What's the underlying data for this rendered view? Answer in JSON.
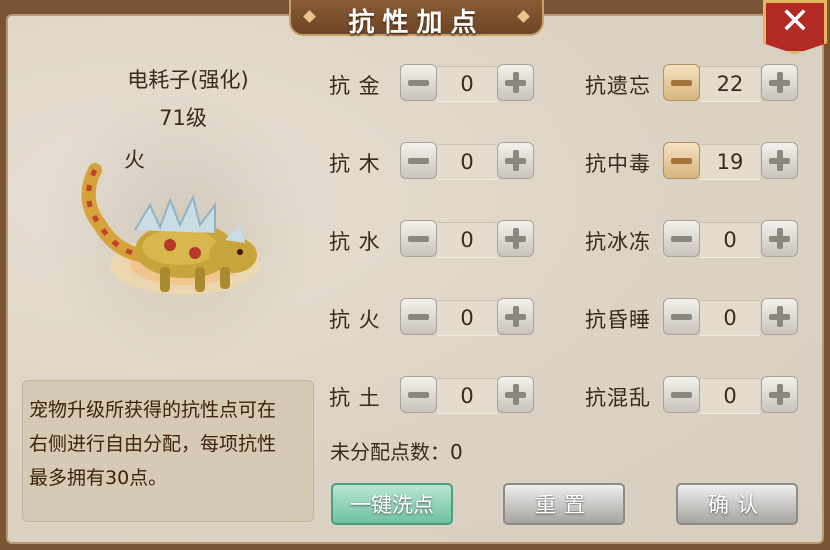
{
  "window": {
    "title": "抗性加点",
    "close_label": "✕"
  },
  "pet": {
    "name": "电耗子(强化)",
    "level": "71级",
    "element": "火"
  },
  "description": {
    "line1": "宠物升级所获得的抗性点可在",
    "line2": "右侧进行自由分配，每项抗性",
    "line3": "最多拥有30点。"
  },
  "stats_left": [
    {
      "label": "抗 金",
      "value": "0"
    },
    {
      "label": "抗 木",
      "value": "0"
    },
    {
      "label": "抗 水",
      "value": "0"
    },
    {
      "label": "抗 火",
      "value": "0"
    },
    {
      "label": "抗 土",
      "value": "0"
    }
  ],
  "stats_right": [
    {
      "label": "抗遗忘",
      "value": "22"
    },
    {
      "label": "抗中毒",
      "value": "19"
    },
    {
      "label": "抗冰冻",
      "value": "0"
    },
    {
      "label": "抗昏睡",
      "value": "0"
    },
    {
      "label": "抗混乱",
      "value": "0"
    }
  ],
  "unallocated": "未分配点数：0",
  "buttons": {
    "reset_all": "一键洗点",
    "reset": "重置",
    "confirm": "确认"
  },
  "colors": {
    "frame": "#7a5535",
    "panel": "#ded5c6",
    "accent_gold": "#e3b663",
    "close_red": "#b22a24",
    "teal_button": "#6fc1a2"
  }
}
